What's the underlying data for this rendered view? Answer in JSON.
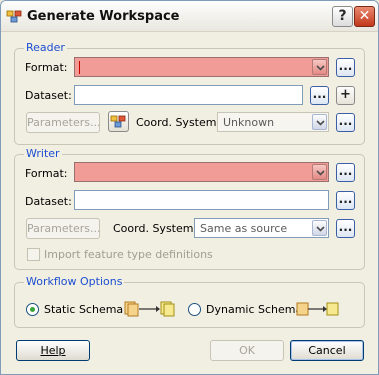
{
  "window": {
    "title": "Generate Workspace",
    "help_glyph": "?",
    "close_glyph": "✕"
  },
  "reader": {
    "section_title": "Reader",
    "format_label": "Format:",
    "format_value": "",
    "dataset_label": "Dataset:",
    "dataset_value": "",
    "browse_label": "...",
    "add_label": "+",
    "parameters_label": "Parameters...",
    "coord_label": "Coord. System:",
    "coord_value": "Unknown"
  },
  "writer": {
    "section_title": "Writer",
    "format_label": "Format:",
    "format_value": "",
    "dataset_label": "Dataset:",
    "dataset_value": "",
    "browse_label": "...",
    "parameters_label": "Parameters...",
    "coord_label": "Coord. System:",
    "coord_value": "Same as source",
    "import_label": "Import feature type definitions"
  },
  "workflow": {
    "section_title": "Workflow Options",
    "static_label": "Static Schema",
    "dynamic_label": "Dynamic Schema",
    "selected": "static"
  },
  "footer": {
    "help_label": "Help",
    "ok_label": "OK",
    "cancel_label": "Cancel"
  },
  "colors": {
    "error_field": "#f29c97",
    "group_title": "#1c4ed1",
    "radio_dot": "#3aa23a"
  }
}
